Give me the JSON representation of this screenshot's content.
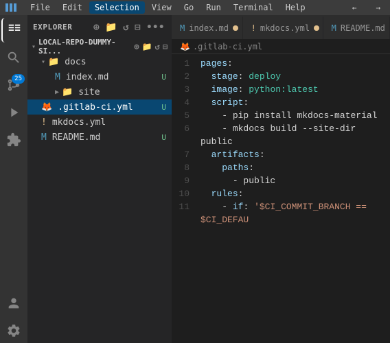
{
  "titleBar": {
    "menu": [
      "File",
      "Edit",
      "Selection",
      "View",
      "Go",
      "Run",
      "Terminal",
      "Help"
    ],
    "activeMenu": "Selection",
    "backArrow": "←",
    "forwardArrow": "→"
  },
  "activityBar": {
    "icons": [
      {
        "name": "explorer-icon",
        "symbol": "📄",
        "active": true
      },
      {
        "name": "search-icon",
        "symbol": "🔍",
        "active": false
      },
      {
        "name": "source-control-icon",
        "symbol": "⎇",
        "badge": "25",
        "active": false
      },
      {
        "name": "run-icon",
        "symbol": "▷",
        "active": false
      },
      {
        "name": "extensions-icon",
        "symbol": "⊞",
        "active": false
      },
      {
        "name": "remote-icon",
        "symbol": "❯",
        "active": false
      }
    ]
  },
  "sidebar": {
    "title": "EXPLORER",
    "repoName": "LOCAL-REPO-DUMMY-SI...",
    "folders": [
      {
        "name": "docs",
        "expanded": true,
        "depth": 1,
        "children": [
          {
            "name": "index.md",
            "depth": 2,
            "status": "U",
            "statusType": "untracked"
          },
          {
            "name": "site",
            "depth": 2,
            "isFolder": true,
            "status": ""
          }
        ]
      }
    ],
    "files": [
      {
        "name": ".gitlab-ci.yml",
        "depth": 1,
        "status": "U",
        "statusType": "untracked",
        "active": true,
        "icon": "gitlab"
      },
      {
        "name": "mkdocs.yml",
        "depth": 1,
        "status": "",
        "statusType": "warning",
        "icon": "warning"
      },
      {
        "name": "README.md",
        "depth": 1,
        "status": "U",
        "statusType": "untracked",
        "icon": "md"
      }
    ]
  },
  "tabs": [
    {
      "label": "index.md",
      "modified": true,
      "active": false,
      "icon": "md"
    },
    {
      "label": "mkdocs.yml",
      "modified": true,
      "active": false,
      "icon": "warning"
    },
    {
      "label": "README.md",
      "modified": false,
      "active": false,
      "icon": "md"
    }
  ],
  "breadcrumb": {
    "items": [
      ".gitlab-ci.yml"
    ]
  },
  "editor": {
    "filename": ".gitlab-ci.yml",
    "lines": [
      {
        "num": 1,
        "content": "pages:"
      },
      {
        "num": 2,
        "content": "  stage: deploy"
      },
      {
        "num": 3,
        "content": "  image: python:latest"
      },
      {
        "num": 4,
        "content": "  script:"
      },
      {
        "num": 5,
        "content": "    - pip install mkdocs-material"
      },
      {
        "num": 6,
        "content": "    - mkdocs build --site-dir public"
      },
      {
        "num": 7,
        "content": "  artifacts:"
      },
      {
        "num": 8,
        "content": "    paths:"
      },
      {
        "num": 9,
        "content": "      - public"
      },
      {
        "num": 10,
        "content": "  rules:"
      },
      {
        "num": 11,
        "content": "    - if: '$CI_COMMIT_BRANCH == $CI_DEFAU"
      }
    ]
  }
}
